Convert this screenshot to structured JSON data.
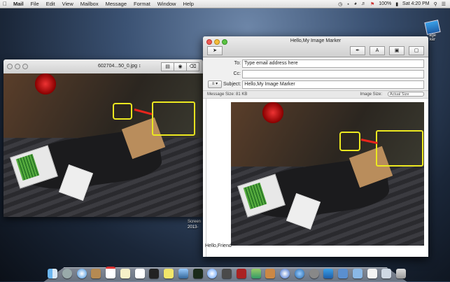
{
  "menubar": {
    "app_name": "Mail",
    "items": [
      "File",
      "Edit",
      "View",
      "Mailbox",
      "Message",
      "Format",
      "Window",
      "Help"
    ],
    "battery": "100%",
    "clock": "Sat 4:20 PM"
  },
  "desktop": {
    "icon_label": "age\nker",
    "screenshot_label": "Screen\n2013-"
  },
  "preview": {
    "title": "602704...50_0.jpg ↕"
  },
  "mail": {
    "title": "Hello,My Image Marker",
    "to_label": "To:",
    "to_placeholder": "Type email address here",
    "cc_label": "Cc:",
    "cc_value": "",
    "subject_label": "Subject:",
    "subject_value": "Hello,My Image Marker",
    "message_size": "Message Size: 81 KB",
    "image_size_label": "Image Size:",
    "image_size_value": "Actual Size",
    "greeting": "Hello,Friend"
  },
  "colors": {
    "marker_yellow": "#ece820",
    "arrow_red": "#e8251c"
  },
  "dock": {
    "icons": [
      "finder-icon",
      "launchpad-icon",
      "safari-icon",
      "contacts-icon",
      "calendar-icon",
      "notes-icon",
      "reminders-icon",
      "terminal-icon",
      "stickies-icon",
      "preview-icon",
      "activity-icon",
      "messages-icon",
      "facetime-icon",
      "photo-booth-icon",
      "iphoto-icon",
      "garageband-icon",
      "itunes-icon",
      "app-store-icon",
      "system-prefs-icon",
      "image-marker-icon",
      "xcode-icon",
      "folder-icon",
      "document-icon",
      "downloads-icon",
      "trash-icon"
    ]
  }
}
